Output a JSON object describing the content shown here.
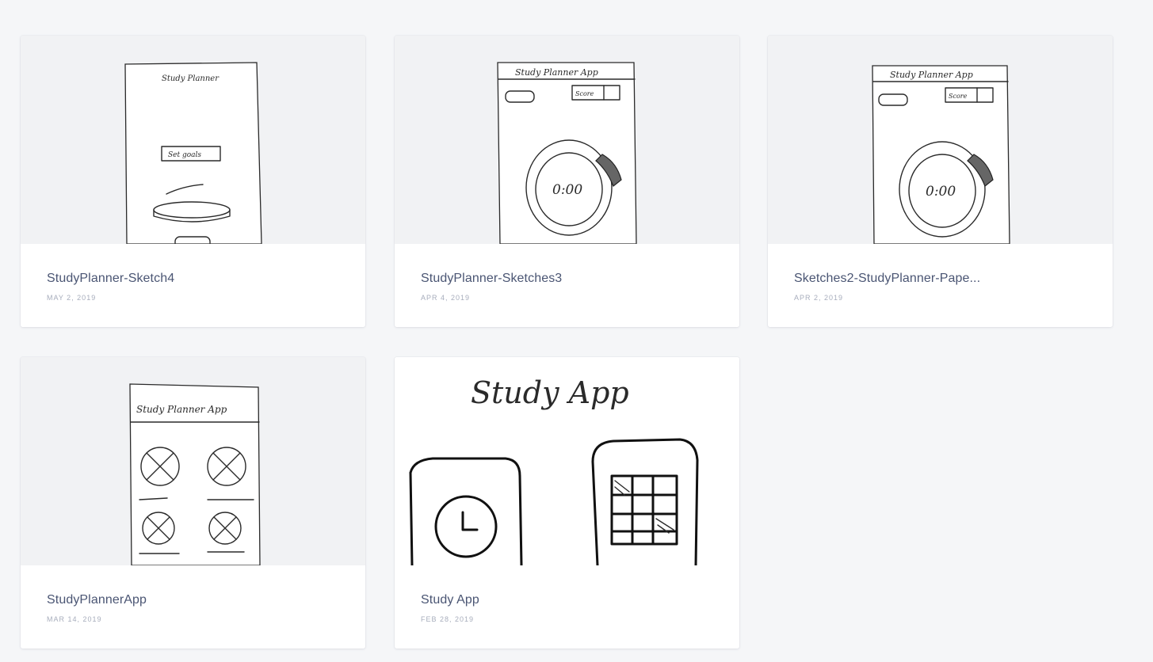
{
  "cards": [
    {
      "title": "StudyPlanner-Sketch4",
      "date": "MAY 2, 2019",
      "thumb_text": [
        "Study Planner",
        "Set goals"
      ]
    },
    {
      "title": "StudyPlanner-Sketches3",
      "date": "APR 4, 2019",
      "thumb_text": [
        "Study Planner App",
        "Score",
        "0:00"
      ]
    },
    {
      "title": "Sketches2-StudyPlanner-Pape...",
      "date": "APR 2, 2019",
      "thumb_text": [
        "Study Planner App",
        "Score",
        "0:00"
      ]
    },
    {
      "title": "StudyPlannerApp",
      "date": "MAR 14, 2019",
      "thumb_text": [
        "Study Planner App"
      ]
    },
    {
      "title": "Study App",
      "date": "FEB 28, 2019",
      "thumb_text": [
        "Study App"
      ]
    }
  ]
}
